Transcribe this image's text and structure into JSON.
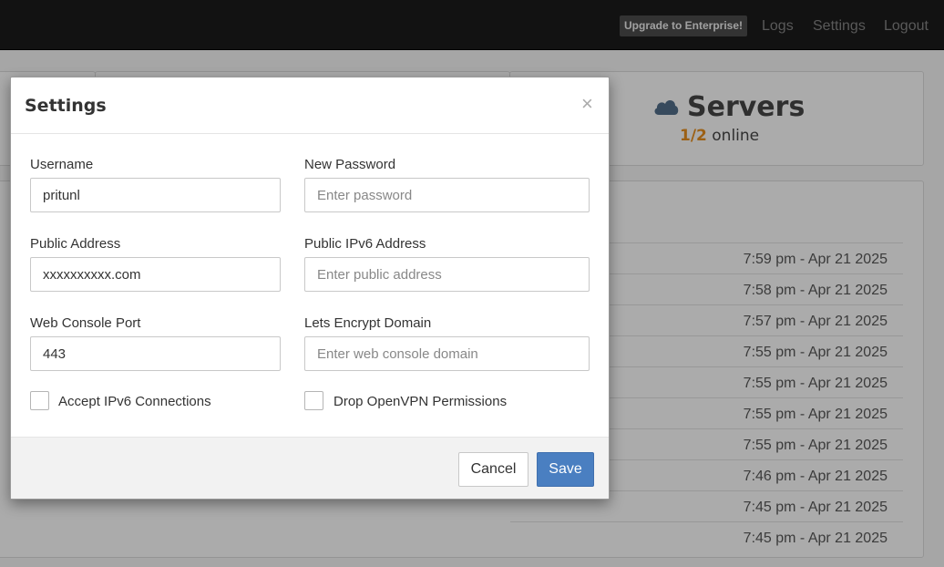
{
  "navbar": {
    "upgrade_label": "Upgrade to Enterprise!",
    "logs_label": "Logs",
    "settings_label": "Settings",
    "logout_label": "Logout"
  },
  "servers": {
    "title": "Servers",
    "online_count": "1/2",
    "online_label": "online",
    "icon": "cloud-icon"
  },
  "log_entries": [
    "7:59 pm - Apr 21 2025",
    "7:58 pm - Apr 21 2025",
    "7:57 pm - Apr 21 2025",
    "7:55 pm - Apr 21 2025",
    "7:55 pm - Apr 21 2025",
    "7:55 pm - Apr 21 2025",
    "7:55 pm - Apr 21 2025",
    "7:46 pm - Apr 21 2025",
    "7:45 pm - Apr 21 2025",
    "7:45 pm - Apr 21 2025"
  ],
  "modal": {
    "title": "Settings",
    "close_symbol": "×",
    "fields": {
      "username": {
        "label": "Username",
        "value": "pritunl",
        "placeholder": ""
      },
      "new_password": {
        "label": "New Password",
        "value": "",
        "placeholder": "Enter password"
      },
      "public_address": {
        "label": "Public Address",
        "value": "xxxxxxxxxx.com",
        "placeholder": ""
      },
      "public_ipv6": {
        "label": "Public IPv6 Address",
        "value": "",
        "placeholder": "Enter public address"
      },
      "web_console_port": {
        "label": "Web Console Port",
        "value": "443",
        "placeholder": ""
      },
      "lets_encrypt": {
        "label": "Lets Encrypt Domain",
        "value": "",
        "placeholder": "Enter web console domain"
      }
    },
    "checkboxes": {
      "accept_ipv6": {
        "label": "Accept IPv6 Connections",
        "checked": false
      },
      "drop_openvpn": {
        "label": "Drop OpenVPN Permissions",
        "checked": false
      }
    },
    "cancel_label": "Cancel",
    "save_label": "Save"
  },
  "colors": {
    "navbar_bg": "#1b1b1b",
    "save_button": "#4a7fc1",
    "server_count": "#e08a1e"
  }
}
